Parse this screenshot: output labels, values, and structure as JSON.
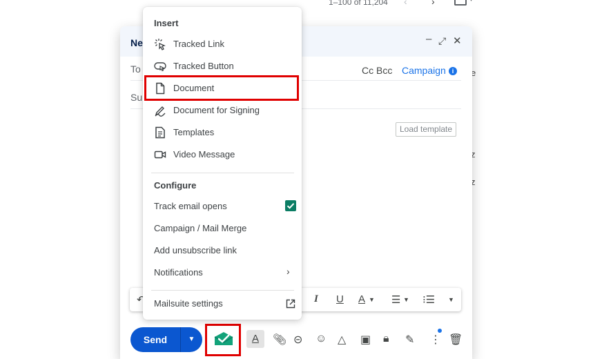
{
  "list": {
    "pager_text": "1–100 of 11,204",
    "right_letters": [
      "e",
      "z",
      "z"
    ]
  },
  "compose": {
    "title": "Ne",
    "to_label": "To",
    "cc_bcc": "Cc Bcc",
    "campaign_label": "Campaign",
    "info_glyph": "i",
    "subject_label": "Su",
    "load_template": "Load template",
    "send_label": "Send",
    "format_toggle_glyph": "A"
  },
  "menu": {
    "insert_heading": "Insert",
    "insert_items": [
      {
        "label": "Tracked Link",
        "icon": "cursor-click-icon"
      },
      {
        "label": "Tracked Button",
        "icon": "button-pointer-icon"
      },
      {
        "label": "Document",
        "icon": "document-icon"
      },
      {
        "label": "Document for Signing",
        "icon": "signature-pen-icon"
      },
      {
        "label": "Templates",
        "icon": "templates-icon"
      },
      {
        "label": "Video Message",
        "icon": "video-camera-icon"
      }
    ],
    "configure_heading": "Configure",
    "configure_items": [
      {
        "label": "Track email opens",
        "checked": true
      },
      {
        "label": "Campaign / Mail Merge"
      },
      {
        "label": "Add unsubscribe link"
      },
      {
        "label": "Notifications",
        "has_submenu": true
      }
    ],
    "settings_label": "Mailsuite settings"
  },
  "colors": {
    "highlight_box": "#e00000",
    "send_blue": "#0b57d0",
    "checkbox_green": "#0b7d64",
    "mailsuite_green": "#12a37a"
  }
}
